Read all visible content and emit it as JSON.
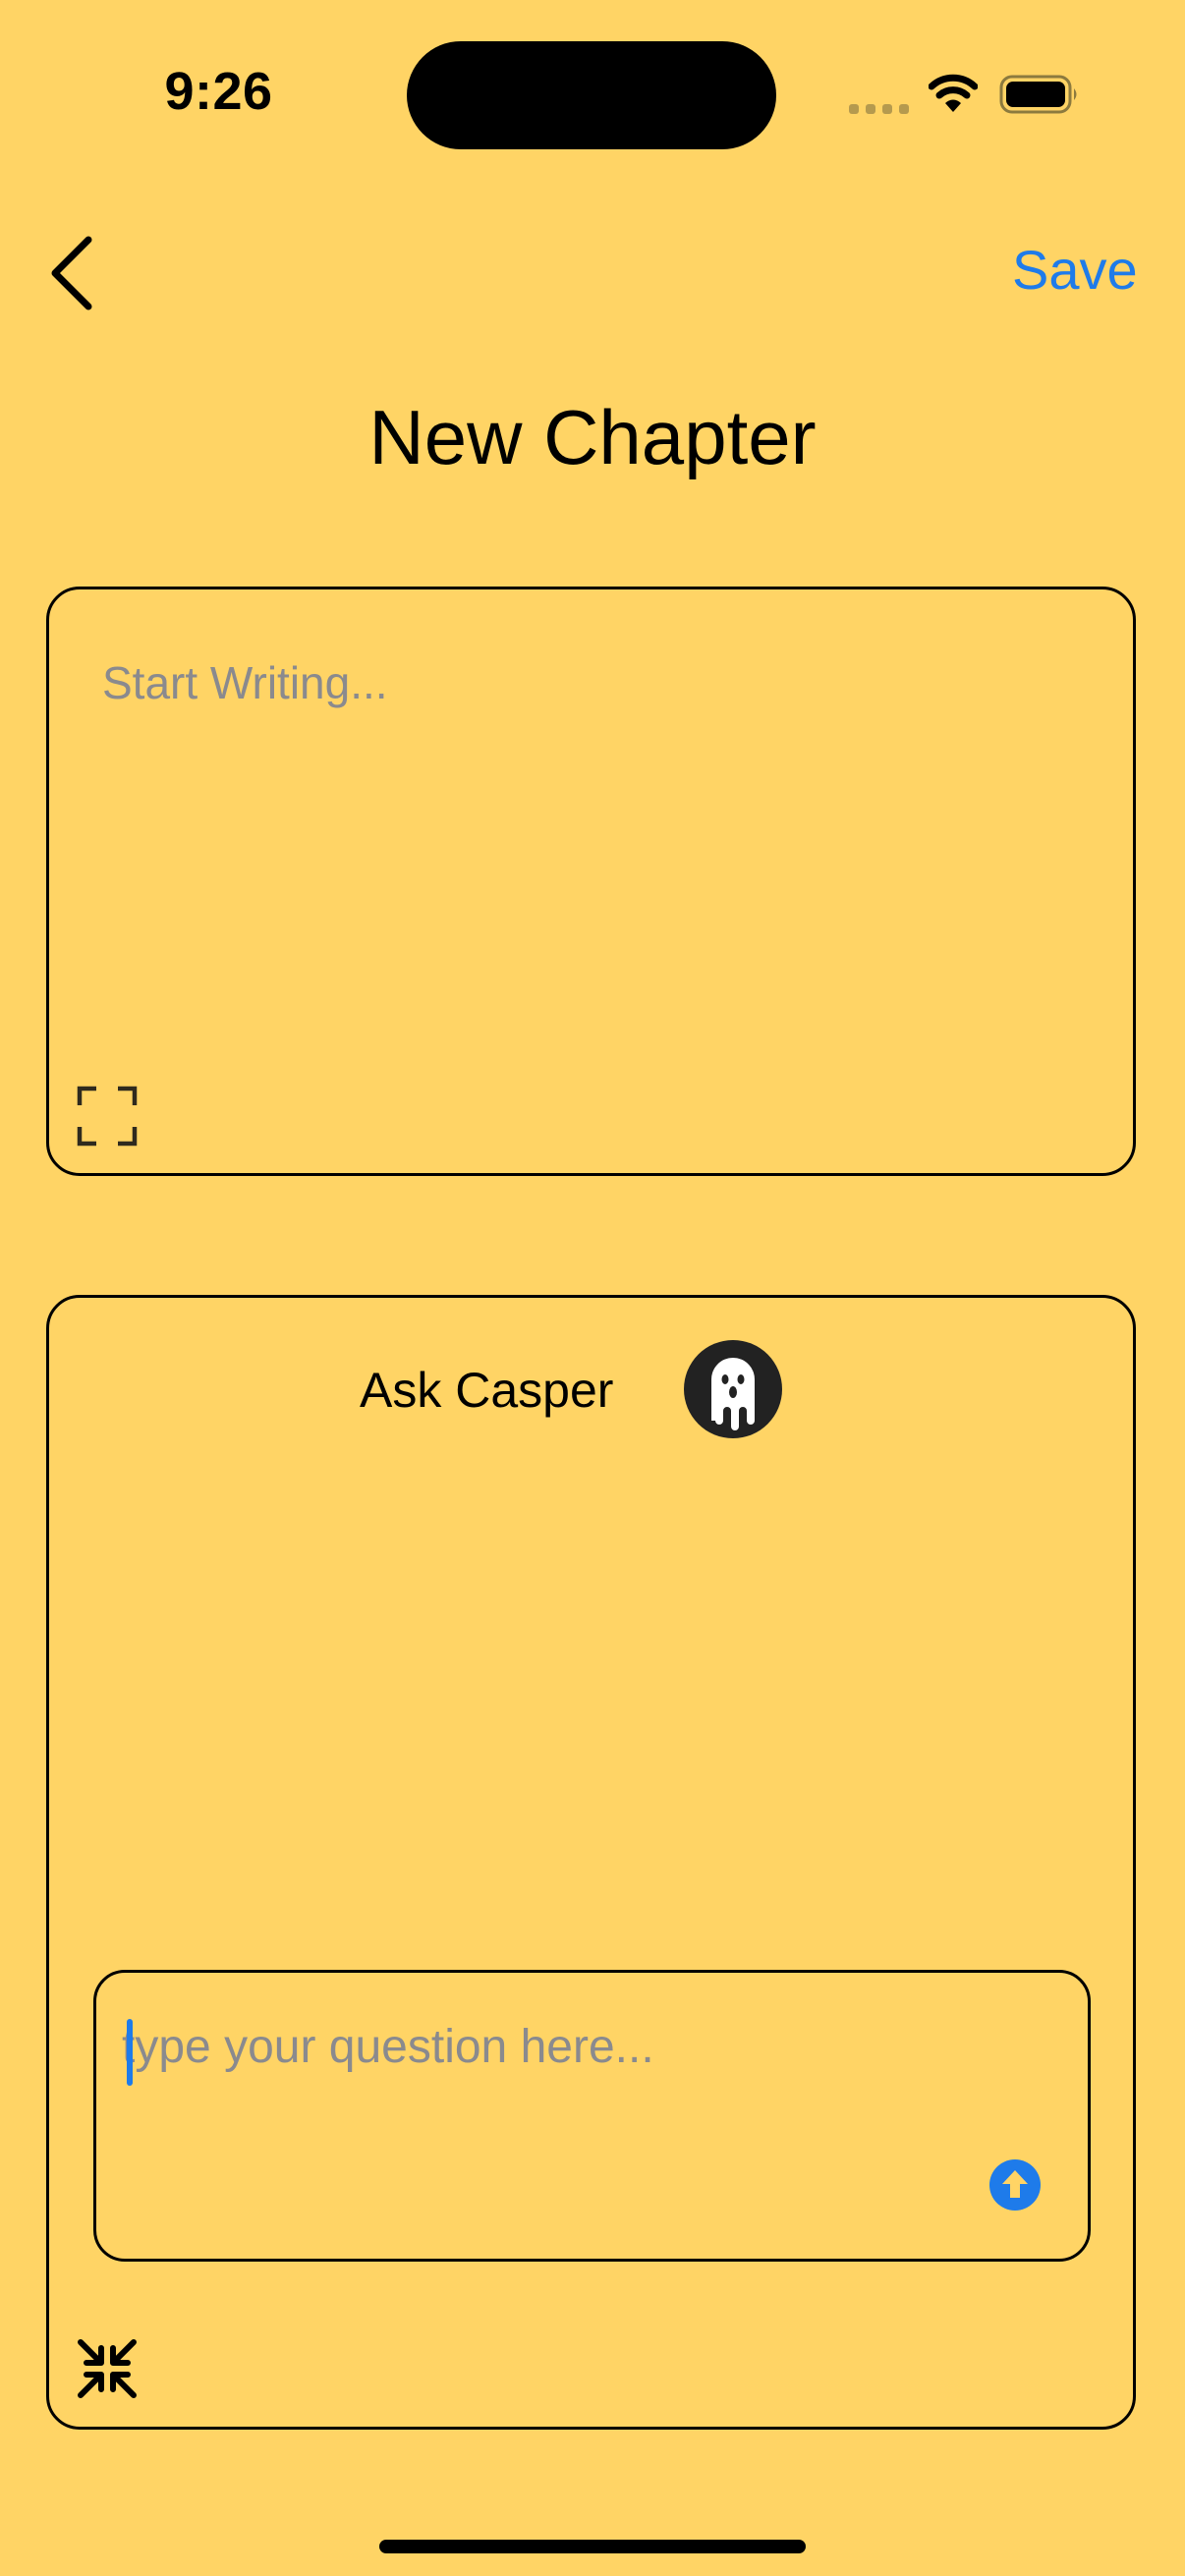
{
  "status_bar": {
    "time": "9:26",
    "icons": [
      "signal-icon",
      "wifi-icon",
      "battery-icon"
    ]
  },
  "nav": {
    "back_icon": "chevron-left-icon",
    "save_label": "Save"
  },
  "page": {
    "title": "New Chapter"
  },
  "writing": {
    "placeholder": "Start Writing...",
    "expand_icon": "expand-icon"
  },
  "chat": {
    "title": "Ask Casper",
    "avatar_icon": "ghost-icon",
    "input_placeholder": "type your question here...",
    "send_icon": "arrow-up-circle-icon",
    "collapse_icon": "collapse-icon"
  },
  "colors": {
    "background": "#FFD465",
    "accent": "#1E7BEA",
    "placeholder": "#8A8A8E"
  }
}
